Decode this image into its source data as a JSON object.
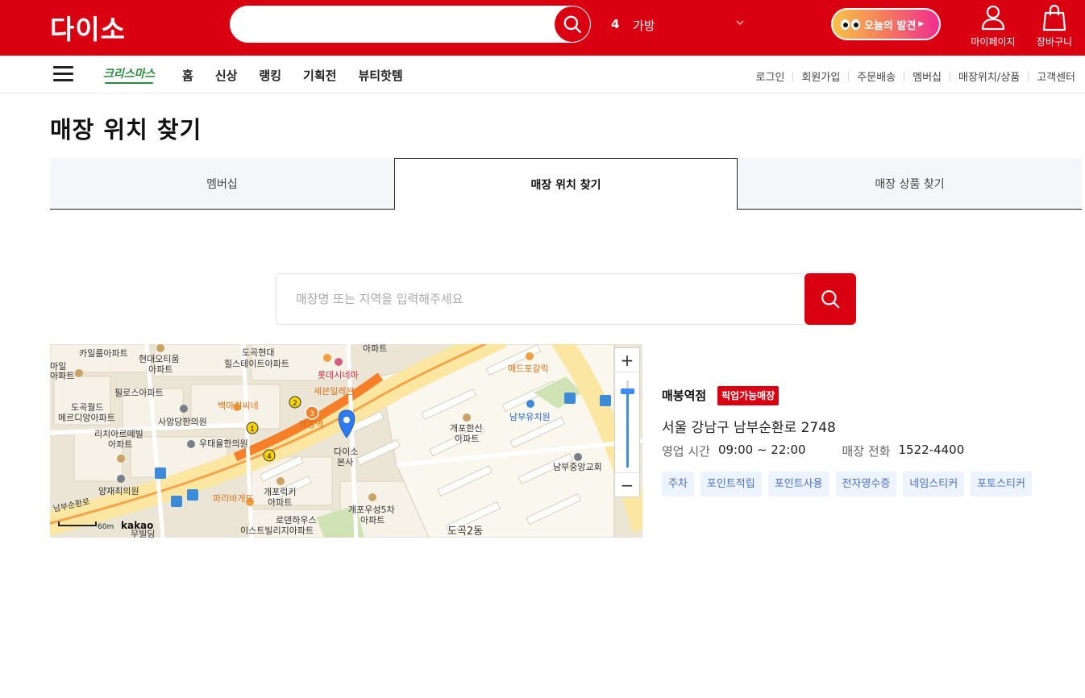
{
  "header": {
    "logo_text": "다이소",
    "search_value": "",
    "ranking_number": "4",
    "ranking_keyword": "가방",
    "discover_label": "오늘의 발견",
    "mypage_label": "마이페이지",
    "cart_label": "장바구니",
    "brand_color": "#d90011"
  },
  "nav": {
    "event_logo_text": "크리스마스",
    "main_items": [
      "홈",
      "신상",
      "랭킹",
      "기획전",
      "뷰티핫템"
    ],
    "util_items": [
      "로그인",
      "회원가입",
      "주문배송",
      "멤버십",
      "매장위치/상품",
      "고객센터"
    ]
  },
  "page": {
    "title": "매장 위치 찾기",
    "tabs": [
      {
        "label": "멤버십",
        "active": false
      },
      {
        "label": "매장 위치 찾기",
        "active": true
      },
      {
        "label": "매장 상품 찾기",
        "active": false
      }
    ]
  },
  "store_search": {
    "placeholder": "매장명 또는 지역을 입력해주세요",
    "value": ""
  },
  "map": {
    "scale_label": "60m",
    "provider": "kakao",
    "zoom_level_fraction": 0.88,
    "labels": [
      "카일룸아파트",
      "현대오티움",
      "아파트",
      "도곡현대",
      "힐스테이트아파트",
      "아파트",
      "롯데시네마",
      "세븐일레븐",
      "매드포갈릭",
      "필로스아파트",
      "백마김씨네",
      "도곡월드",
      "메르디앙아파트",
      "사암당한의원",
      "매봉역",
      "다이소",
      "본사",
      "개포한신",
      "아파트",
      "남부유치원",
      "리치아르떼빌",
      "아파트",
      "우태율한의원",
      "남부중앙교회",
      "양재최의원",
      "파리바게뜨",
      "개포럭키",
      "아파트",
      "개포우성5차",
      "아파트",
      "로덴하우스",
      "이스트빌리지아파트",
      "도곡2동",
      "남부순환로",
      "마일",
      "아파트",
      "무빌딩"
    ]
  },
  "store": {
    "name": "매봉역점",
    "badge": "픽업가능매장",
    "address": "서울 강남구 남부순환로 2748",
    "hours_label": "영업 시간",
    "hours_value": "09:00 ~ 22:00",
    "phone_label": "매장 전화",
    "phone_value": "1522-4400",
    "tags": [
      "주차",
      "포인트적립",
      "포인트사용",
      "전자영수증",
      "네임스티커",
      "포토스티커"
    ]
  }
}
